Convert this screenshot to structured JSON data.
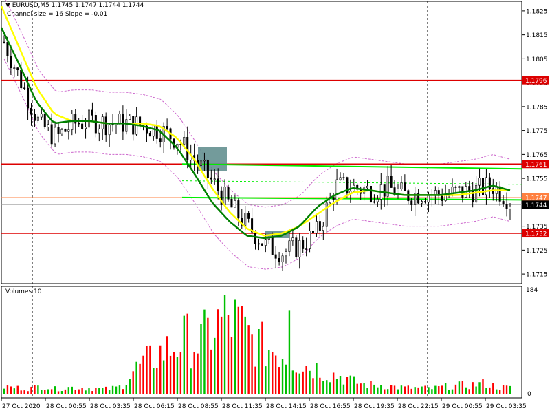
{
  "header": {
    "symbol_line": "EURUSD,M5  1.1745 1.1747 1.1744 1.1744",
    "indicator_line": "Channel size = 16 Slope = -0.01"
  },
  "volumes_panel": {
    "title": "Volumes 10",
    "max_label": "184",
    "zero_label": "0"
  },
  "colors": {
    "background": "#ffffff",
    "grid": "#c0c0c0",
    "candles": "#000000",
    "ma_fast": "#008000",
    "ma_slow": "#ffff00",
    "envelope": "#cc66cc",
    "level_lines": "#dd0000",
    "channel": "#00ee00",
    "bid_line": "#ff8040",
    "highlight": "#5a8a8a",
    "vol_up": "#00c000",
    "vol_down": "#ff0000"
  },
  "chart_data": {
    "type": "candlestick",
    "title": "EURUSD,M5",
    "ylim": [
      1.1711,
      1.1829
    ],
    "y_ticks": [
      "1.1825",
      "1.1815",
      "1.1805",
      "1.1795",
      "1.1785",
      "1.1775",
      "1.1765",
      "1.1755",
      "1.1745",
      "1.1735",
      "1.1725",
      "1.1715"
    ],
    "x_ticks": [
      "27 Oct 2020",
      "28 Oct 00:55",
      "28 Oct 03:35",
      "28 Oct 06:15",
      "28 Oct 08:55",
      "28 Oct 11:35",
      "28 Oct 14:15",
      "28 Oct 16:55",
      "28 Oct 19:35",
      "28 Oct 22:15",
      "29 Oct 00:55",
      "29 Oct 03:35"
    ],
    "levels": [
      {
        "label": "1.1796",
        "value": 1.1796
      },
      {
        "label": "1.1761",
        "value": 1.1761
      },
      {
        "label": "1.1732",
        "value": 1.1732
      }
    ],
    "bid": {
      "label": "1.1744",
      "value": 1.1744
    },
    "ask": {
      "label": "1.1747",
      "value": 1.1747
    },
    "channel": {
      "upper": [
        1.1761,
        1.1759
      ],
      "lower": [
        1.1747,
        1.1746
      ]
    },
    "price_path": [
      1.1812,
      1.1795,
      1.1778,
      1.1772,
      1.1778,
      1.1779,
      1.1778,
      1.1778,
      1.1777,
      1.1775,
      1.1771,
      1.1762,
      1.1753,
      1.1743,
      1.1735,
      1.1727,
      1.1724,
      1.1727,
      1.1733,
      1.1752,
      1.1751,
      1.175,
      1.1751,
      1.1748,
      1.1749,
      1.1748,
      1.1749,
      1.175,
      1.1752,
      1.1746
    ],
    "ma_slow": [
      1.1827,
      1.181,
      1.1793,
      1.1782,
      1.1779,
      1.1779,
      1.1778,
      1.1778,
      1.1778,
      1.1777,
      1.1772,
      1.1763,
      1.1751,
      1.1741,
      1.1734,
      1.1731,
      1.1732,
      1.1735,
      1.174,
      1.1745,
      1.1749,
      1.175,
      1.1749,
      1.1748,
      1.1748,
      1.1748,
      1.1748,
      1.1749,
      1.175,
      1.175
    ],
    "ma_fast": [
      1.1818,
      1.1803,
      1.1787,
      1.1778,
      1.1779,
      1.1779,
      1.1778,
      1.1778,
      1.1777,
      1.1775,
      1.1768,
      1.1757,
      1.1745,
      1.1737,
      1.1731,
      1.173,
      1.1731,
      1.1735,
      1.1743,
      1.1748,
      1.1751,
      1.175,
      1.1749,
      1.1748,
      1.1748,
      1.1748,
      1.1749,
      1.175,
      1.1752,
      1.175
    ],
    "volume_max": 184,
    "volumes": [
      12,
      10,
      9,
      14,
      8,
      11,
      10,
      9,
      8,
      12,
      40,
      55,
      70,
      80,
      95,
      85,
      110,
      130,
      120,
      95,
      80,
      75,
      65,
      50,
      45,
      35,
      30,
      20,
      15,
      15,
      12,
      10,
      10,
      9,
      12,
      14,
      15,
      18,
      12,
      10
    ]
  }
}
